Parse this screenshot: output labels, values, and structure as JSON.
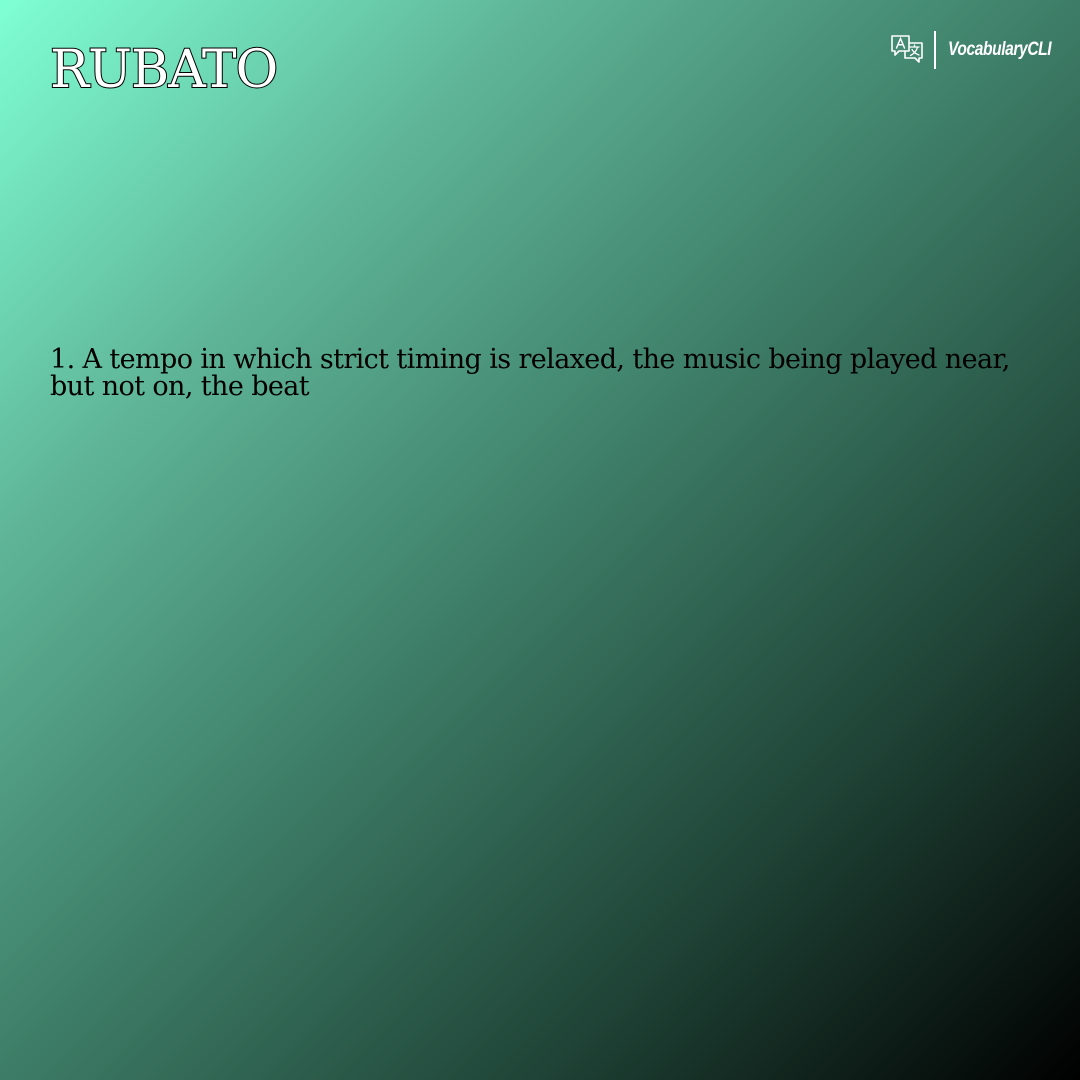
{
  "word": "RUBATO",
  "brand": {
    "name": "VocabularyCLI",
    "icon": "translate-icon"
  },
  "definitions": [
    {
      "text": "1. A tempo in which strict timing is relaxed, the music being played near, but not on, the beat"
    }
  ],
  "colors": {
    "gradient_start": "#7fffd4",
    "gradient_end": "#000000",
    "title_fill": "#ffffff",
    "title_outline": "#000000",
    "definition_text": "#000000",
    "brand_text": "#ffffff"
  }
}
